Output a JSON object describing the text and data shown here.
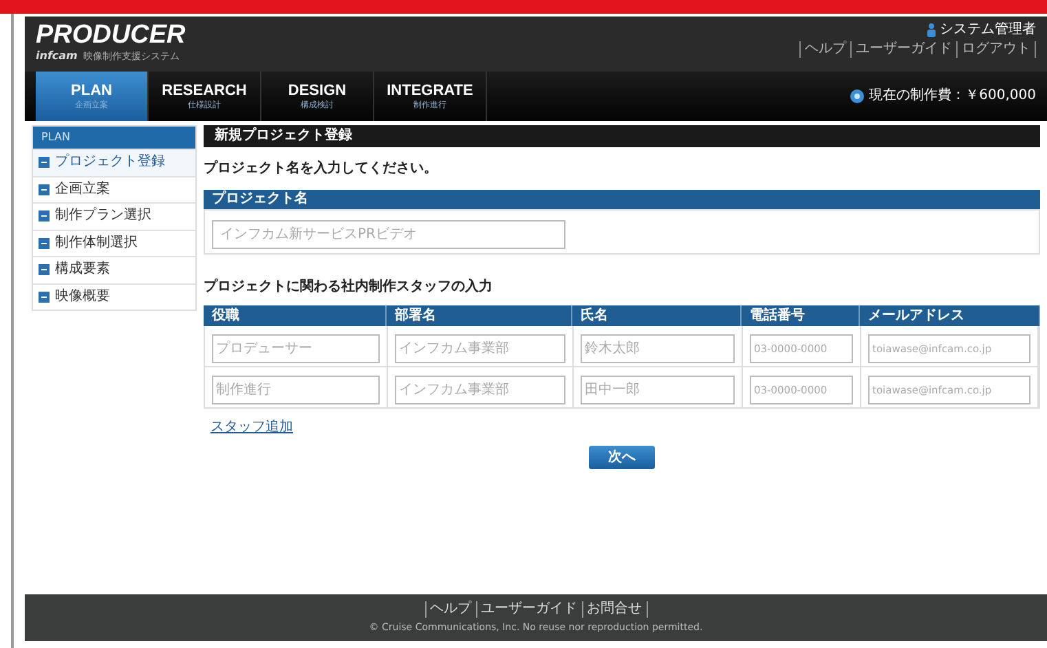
{
  "header": {
    "logo": "PRODUCER",
    "brand": "infcam",
    "tagline": "映像制作支援システム",
    "user": "システム管理者",
    "links": [
      "ヘルプ",
      "ユーザーガイド",
      "ログアウト"
    ]
  },
  "tabs": [
    {
      "label": "PLAN",
      "sublabel": "企画立案",
      "selected": true
    },
    {
      "label": "RESEARCH",
      "sublabel": "仕様設計",
      "selected": false
    },
    {
      "label": "DESIGN",
      "sublabel": "構成検討",
      "selected": false
    },
    {
      "label": "INTEGRATE",
      "sublabel": "制作進行",
      "selected": false
    }
  ],
  "cost": "現在の制作費：￥600,000",
  "sidebar": {
    "title": "PLAN",
    "items": [
      {
        "label": "プロジェクト登録",
        "selected": true
      },
      {
        "label": "企画立案",
        "selected": false
      },
      {
        "label": "制作プラン選択",
        "selected": false
      },
      {
        "label": "制作体制選択",
        "selected": false
      },
      {
        "label": "構成要素",
        "selected": false
      },
      {
        "label": "映像概要",
        "selected": false
      }
    ]
  },
  "main": {
    "title": "新規プロジェクト登録",
    "instruction": "プロジェクト名を入力してください。",
    "project_name": {
      "label": "プロジェクト名",
      "placeholder": "インフカム新サービスPRビデオ"
    },
    "staff_heading": "プロジェクトに関わる社内制作スタッフの入力",
    "table": {
      "columns": [
        "役職",
        "部署名",
        "氏名",
        "電話番号",
        "メールアドレス"
      ],
      "rows": [
        [
          {
            "placeholder": "プロデューサー"
          },
          {
            "placeholder": "インフカム事業部"
          },
          {
            "placeholder": "鈴木太郎"
          },
          {
            "placeholder": "03-0000-0000"
          },
          {
            "placeholder": "toiawase@infcam.co.jp"
          }
        ],
        [
          {
            "placeholder": "制作進行"
          },
          {
            "placeholder": "インフカム事業部"
          },
          {
            "placeholder": "田中一郎"
          },
          {
            "placeholder": "03-0000-0000"
          },
          {
            "placeholder": "toiawase@infcam.co.jp"
          }
        ]
      ]
    },
    "add_link": "スタッフ追加",
    "next_button": "次へ"
  },
  "footer": {
    "links": [
      "ヘルプ",
      "ユーザーガイド",
      "お問合せ"
    ],
    "copyright": "© Cruise Communications, Inc. No reuse nor reproduction permitted."
  }
}
